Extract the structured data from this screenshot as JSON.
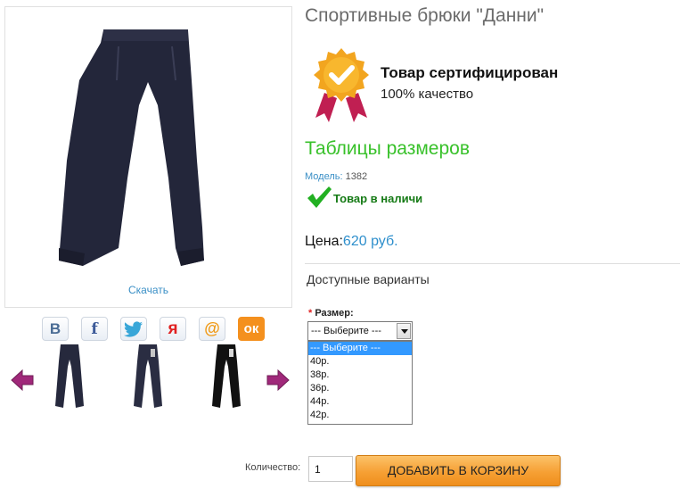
{
  "product": {
    "title": "Спортивные брюки \"Данни\"",
    "download_label": "Скачать",
    "cert_title": "Товар сертифицирован",
    "cert_subtitle": "100% качество",
    "size_table_link": "Таблицы размеров",
    "model_label": "Модель:",
    "model_value": "1382",
    "stock_status": "Товар в наличи",
    "price_label": "Цена:",
    "price_value": "620 руб.",
    "variants_heading": "Доступные варианты"
  },
  "social": [
    {
      "icon": "vk-icon",
      "glyph": "В"
    },
    {
      "icon": "facebook-icon",
      "glyph": "f"
    },
    {
      "icon": "twitter-icon",
      "glyph": "🐦"
    },
    {
      "icon": "yaru-icon",
      "glyph": "я"
    },
    {
      "icon": "mailru-icon",
      "glyph": "@"
    },
    {
      "icon": "odnoklassniki-icon",
      "glyph": "ок"
    }
  ],
  "size_option": {
    "required_mark": "*",
    "label": "Размер:",
    "selected": "--- Выберите ---",
    "options": [
      "--- Выберите ---",
      "40р.",
      "38р.",
      "36р.",
      "44р.",
      "42р."
    ]
  },
  "cart": {
    "quantity_label": "Количество:",
    "quantity_value": "1",
    "add_button": "ДОБАВИТЬ В КОРЗИНУ"
  },
  "colors": {
    "accent_green": "#38c12a",
    "link_blue": "#3a8fc6",
    "price_blue": "#2e8fcc",
    "cart_orange": "#f6a034",
    "arrow_purple": "#a0287a"
  }
}
